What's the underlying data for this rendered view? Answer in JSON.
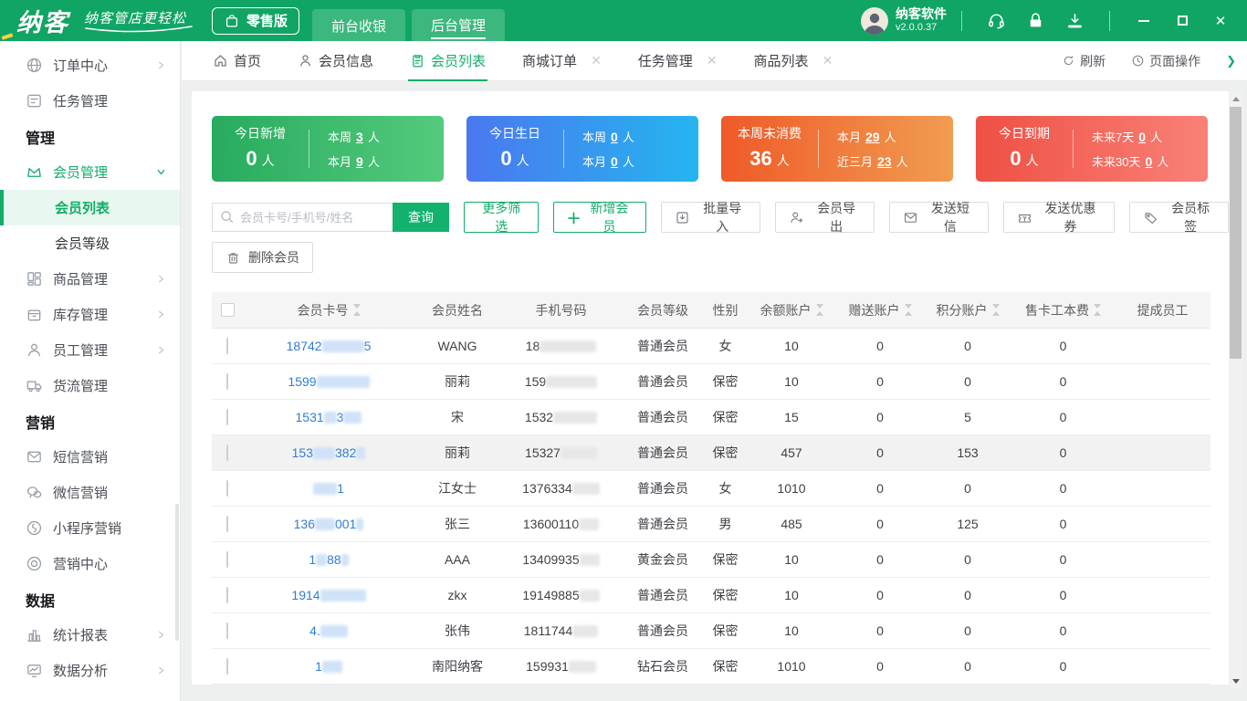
{
  "titlebar": {
    "logo": "纳客",
    "tagline": "纳客管店更轻松",
    "edition": "零售版",
    "nav": [
      {
        "label": "前台收银",
        "active": false
      },
      {
        "label": "后台管理",
        "active": true
      }
    ],
    "user_name": "纳客软件",
    "version": "v2.0.0.37",
    "window_icons": [
      "customer-service",
      "lock",
      "download",
      "minimize",
      "maximize",
      "close"
    ]
  },
  "colors": {
    "header_green": "#10a564",
    "accent_green": "#12ad68",
    "link_blue": "#2e7cd6"
  },
  "sidebar": {
    "items": [
      {
        "type": "item",
        "label": "订单中心",
        "icon": "globe",
        "chevron": "right"
      },
      {
        "type": "item",
        "label": "任务管理",
        "icon": "task"
      },
      {
        "type": "section",
        "label": "管理"
      },
      {
        "type": "item",
        "label": "会员管理",
        "icon": "crown",
        "chevron": "down",
        "active": true
      },
      {
        "type": "sub",
        "label": "会员列表",
        "active": true
      },
      {
        "type": "sub",
        "label": "会员等级"
      },
      {
        "type": "item",
        "label": "商品管理",
        "icon": "goods",
        "chevron": "right"
      },
      {
        "type": "item",
        "label": "库存管理",
        "icon": "inventory",
        "chevron": "right"
      },
      {
        "type": "item",
        "label": "员工管理",
        "icon": "staff",
        "chevron": "right"
      },
      {
        "type": "item",
        "label": "货流管理",
        "icon": "truck"
      },
      {
        "type": "section",
        "label": "营销"
      },
      {
        "type": "item",
        "label": "短信营销",
        "icon": "envelope"
      },
      {
        "type": "item",
        "label": "微信营销",
        "icon": "wechat"
      },
      {
        "type": "item",
        "label": "小程序营销",
        "icon": "miniapp"
      },
      {
        "type": "item",
        "label": "营销中心",
        "icon": "target"
      },
      {
        "type": "section",
        "label": "数据"
      },
      {
        "type": "item",
        "label": "统计报表",
        "icon": "chart",
        "chevron": "right"
      },
      {
        "type": "item",
        "label": "数据分析",
        "icon": "analysis",
        "chevron": "right"
      }
    ]
  },
  "tabs": {
    "items": [
      {
        "label": "首页",
        "icon": "home"
      },
      {
        "label": "会员信息",
        "icon": "person"
      },
      {
        "label": "会员列表",
        "icon": "clipboard",
        "active": true
      },
      {
        "label": "商城订单",
        "closable": true
      },
      {
        "label": "任务管理",
        "closable": true
      },
      {
        "label": "商品列表",
        "closable": true
      }
    ],
    "refresh_label": "刷新",
    "page_ops_label": "页面操作"
  },
  "cards": [
    {
      "title": "今日新增",
      "value": "0",
      "unit": "人",
      "gradient": [
        "#27ab5e",
        "#55ca7d"
      ],
      "stats": [
        {
          "label": "本周",
          "value": "3",
          "unit": "人"
        },
        {
          "label": "本月",
          "value": "9",
          "unit": "人"
        }
      ]
    },
    {
      "title": "今日生日",
      "value": "0",
      "unit": "人",
      "gradient": [
        "#4a78ef",
        "#25b5ef"
      ],
      "stats": [
        {
          "label": "本周",
          "value": "0",
          "unit": "人"
        },
        {
          "label": "本月",
          "value": "0",
          "unit": "人"
        }
      ]
    },
    {
      "title": "本周未消费",
      "value": "36",
      "unit": "人",
      "gradient": [
        "#ef5a28",
        "#f19c50"
      ],
      "stats": [
        {
          "label": "本月",
          "value": "29",
          "unit": "人"
        },
        {
          "label": "近三月",
          "value": "23",
          "unit": "人"
        }
      ]
    },
    {
      "title": "今日到期",
      "value": "0",
      "unit": "人",
      "gradient": [
        "#ef5044",
        "#f98177"
      ],
      "stats": [
        {
          "label": "未来7天",
          "value": "0",
          "unit": "人"
        },
        {
          "label": "未来30天",
          "value": "0",
          "unit": "人"
        }
      ]
    }
  ],
  "toolbar": {
    "search_placeholder": "会员卡号/手机号/姓名",
    "query_label": "查询",
    "buttons_row1": [
      {
        "label": "更多筛选",
        "style": "outline"
      },
      {
        "label": "新增会员",
        "style": "outline",
        "plus": true
      },
      {
        "label": "批量导入",
        "style": "gray",
        "icon": "import"
      },
      {
        "label": "会员导出",
        "style": "gray",
        "icon": "export"
      },
      {
        "label": "发送短信",
        "style": "gray",
        "icon": "envelope"
      },
      {
        "label": "发送优惠券",
        "style": "gray",
        "icon": "coupon"
      },
      {
        "label": "会员标签",
        "style": "gray",
        "icon": "tag"
      }
    ],
    "buttons_row2": [
      {
        "label": "删除会员",
        "style": "gray",
        "icon": "trash"
      }
    ]
  },
  "table": {
    "columns": [
      {
        "key": "check",
        "label": "",
        "type": "checkbox"
      },
      {
        "key": "card",
        "label": "会员卡号",
        "sortable": true
      },
      {
        "key": "name",
        "label": "会员姓名"
      },
      {
        "key": "phone",
        "label": "手机号码"
      },
      {
        "key": "level",
        "label": "会员等级"
      },
      {
        "key": "gender",
        "label": "性别"
      },
      {
        "key": "balance",
        "label": "余额账户",
        "sortable": true
      },
      {
        "key": "gift",
        "label": "赠送账户",
        "sortable": true
      },
      {
        "key": "points",
        "label": "积分账户",
        "sortable": true
      },
      {
        "key": "fee",
        "label": "售卡工本费",
        "sortable": true
      },
      {
        "key": "staff",
        "label": "提成员工"
      }
    ],
    "rows": [
      {
        "card": [
          [
            "t",
            "18742"
          ],
          [
            "b",
            46
          ],
          [
            "t",
            "5"
          ]
        ],
        "name": "WANG",
        "phone": [
          [
            "t",
            "18"
          ],
          [
            "b",
            62
          ]
        ],
        "level": "普通会员",
        "gender": "女",
        "balance": "10",
        "gift": "0",
        "points": "0",
        "fee": "0",
        "staff": "",
        "highlight": false
      },
      {
        "card": [
          [
            "t",
            "1599"
          ],
          [
            "b",
            58
          ]
        ],
        "name": "丽莉",
        "phone": [
          [
            "t",
            "159"
          ],
          [
            "b",
            56
          ]
        ],
        "level": "普通会员",
        "gender": "保密",
        "balance": "10",
        "gift": "0",
        "points": "0",
        "fee": "0",
        "staff": "",
        "highlight": false
      },
      {
        "card": [
          [
            "t",
            "1531"
          ],
          [
            "b",
            14
          ],
          [
            "t",
            "3"
          ],
          [
            "b",
            20
          ]
        ],
        "name": "宋",
        "phone": [
          [
            "t",
            "1532"
          ],
          [
            "b",
            48
          ]
        ],
        "level": "普通会员",
        "gender": "保密",
        "balance": "15",
        "gift": "0",
        "points": "5",
        "fee": "0",
        "staff": "",
        "highlight": false
      },
      {
        "card": [
          [
            "t",
            "153"
          ],
          [
            "b",
            24
          ],
          [
            "t",
            "382"
          ],
          [
            "b",
            10
          ]
        ],
        "name": "丽莉",
        "phone": [
          [
            "t",
            "15327"
          ],
          [
            "b",
            40
          ]
        ],
        "level": "普通会员",
        "gender": "保密",
        "balance": "457",
        "gift": "0",
        "points": "153",
        "fee": "0",
        "staff": "",
        "highlight": true
      },
      {
        "card": [
          [
            "b",
            26
          ],
          [
            "t",
            "1"
          ]
        ],
        "name": "江女士",
        "phone": [
          [
            "t",
            "1376334"
          ],
          [
            "b",
            30
          ]
        ],
        "level": "普通会员",
        "gender": "女",
        "balance": "1010",
        "gift": "0",
        "points": "0",
        "fee": "0",
        "staff": "",
        "highlight": false
      },
      {
        "card": [
          [
            "t",
            "136"
          ],
          [
            "b",
            22
          ],
          [
            "t",
            "001"
          ],
          [
            "b",
            8
          ]
        ],
        "name": "张三",
        "phone": [
          [
            "t",
            "13600110"
          ],
          [
            "b",
            22
          ]
        ],
        "level": "普通会员",
        "gender": "男",
        "balance": "485",
        "gift": "0",
        "points": "125",
        "fee": "0",
        "staff": "",
        "highlight": false
      },
      {
        "card": [
          [
            "t",
            "1"
          ],
          [
            "b",
            12
          ],
          [
            "t",
            "88"
          ],
          [
            "b",
            8
          ]
        ],
        "name": "AAA",
        "phone": [
          [
            "t",
            "13409935"
          ],
          [
            "b",
            22
          ]
        ],
        "level": "黄金会员",
        "gender": "保密",
        "balance": "10",
        "gift": "0",
        "points": "0",
        "fee": "0",
        "staff": "",
        "highlight": false
      },
      {
        "card": [
          [
            "t",
            "1914"
          ],
          [
            "b",
            50
          ]
        ],
        "name": "zkx",
        "phone": [
          [
            "t",
            "19149885"
          ],
          [
            "b",
            22
          ]
        ],
        "level": "普通会员",
        "gender": "保密",
        "balance": "10",
        "gift": "0",
        "points": "0",
        "fee": "0",
        "staff": "",
        "highlight": false
      },
      {
        "card": [
          [
            "t",
            "4."
          ],
          [
            "b",
            30
          ]
        ],
        "name": "张伟",
        "phone": [
          [
            "t",
            "1811744"
          ],
          [
            "b",
            28
          ]
        ],
        "level": "普通会员",
        "gender": "保密",
        "balance": "10",
        "gift": "0",
        "points": "0",
        "fee": "0",
        "staff": "",
        "highlight": false
      },
      {
        "card": [
          [
            "t",
            "1"
          ],
          [
            "b",
            22
          ]
        ],
        "name": "南阳纳客",
        "phone": [
          [
            "t",
            "159931"
          ],
          [
            "b",
            30
          ]
        ],
        "level": "钻石会员",
        "gender": "保密",
        "balance": "1010",
        "gift": "0",
        "points": "0",
        "fee": "0",
        "staff": "",
        "highlight": false
      }
    ]
  }
}
